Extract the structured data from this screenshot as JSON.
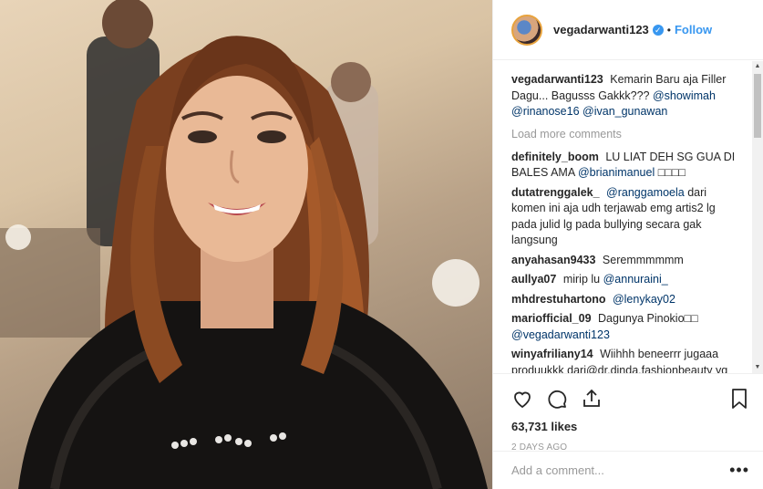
{
  "post": {
    "username": "vegadarwanti123",
    "verified_badge": "✓",
    "separator": "•",
    "follow_label": "Follow",
    "caption_text": "Kemarin Baru aja Filler Dagu... Bagusss Gakkk???",
    "caption_mentions": [
      "@showimah",
      "@rinanose16",
      "@ivan_gunawan"
    ],
    "load_more": "Load more comments",
    "likes": "63,731 likes",
    "date": "2 DAYS AGO",
    "add_comment_placeholder": "Add a comment...",
    "more_icon_text": "•••"
  },
  "comments": [
    {
      "user": "definitely_boom",
      "text": "LU LIAT DEH SG GUA DI BALES AMA",
      "mention": "@brianimanuel",
      "tail": "□□□□"
    },
    {
      "user": "dutatrenggalek_",
      "mention": "@ranggamoela",
      "text": "dari komen ini aja udh terjawab emg artis2 lg pada julid lg pada bullying secara gak langsung"
    },
    {
      "user": "anyahasan9433",
      "text": "Seremmmmmm"
    },
    {
      "user": "aullya07",
      "text": "mirip lu",
      "mention": "@annuraini_"
    },
    {
      "user": "mhdrestuhartono",
      "mention": "@lenykay02"
    },
    {
      "user": "mariofficial_09",
      "text": "Dagunya Pinokio□□",
      "mention": "@vegadarwanti123"
    },
    {
      "user": "winyafriliany14",
      "text": "Wiihhh beneerrr jugaaa produukkk dari@dr.dinda.fashionbeauty yg disaranjin kakaaak kuliittttt akuuu"
    }
  ],
  "icons": [
    "heart-icon",
    "comment-icon",
    "share-icon",
    "bookmark-icon"
  ],
  "colors": {
    "link": "#3897f0",
    "mention": "#003569",
    "muted": "#999999",
    "text": "#262626"
  }
}
